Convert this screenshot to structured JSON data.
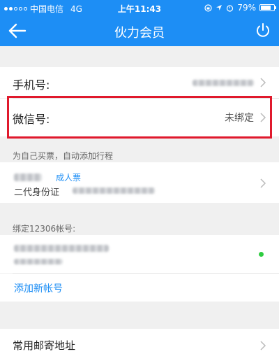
{
  "statusbar": {
    "carrier": "中国电信",
    "network": "4G",
    "time": "上午11:43",
    "battery": "79%",
    "battery_level": 0.79
  },
  "navbar": {
    "title": "伙力会员",
    "back_icon": "arrow-left-icon",
    "power_icon": "power-icon"
  },
  "account": {
    "phone_label": "手机号:",
    "wechat_label": "微信号:",
    "wechat_value": "未绑定"
  },
  "passengers": {
    "section_label": "为自己买票，自动添加行程",
    "ticket_type": "成人票",
    "id_type": "二代身份证"
  },
  "accounts12306": {
    "section_label": "绑定12306帐号:",
    "add_label": "添加新帐号"
  },
  "address": {
    "label": "常用邮寄地址"
  },
  "colors": {
    "accent": "#1d8ef5",
    "link": "#1d8ef5",
    "highlight": "#e0192c",
    "online": "#2ecc40"
  }
}
